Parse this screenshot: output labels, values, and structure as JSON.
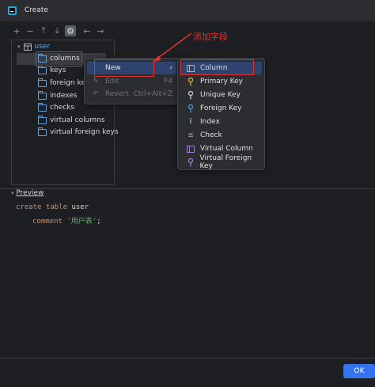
{
  "window": {
    "title": "Create",
    "app_icon": "datagrip-icon"
  },
  "toolbar": [
    {
      "name": "add-icon",
      "glyph": "+"
    },
    {
      "name": "remove-icon",
      "glyph": "−"
    },
    {
      "name": "move-up-icon",
      "glyph": "⤒"
    },
    {
      "name": "move-down-icon",
      "glyph": "⤓"
    },
    {
      "name": "settings-icon",
      "glyph": "⚙"
    },
    {
      "name": "back-icon",
      "glyph": "←"
    },
    {
      "name": "forward-icon",
      "glyph": "→"
    }
  ],
  "tree": {
    "root": "user",
    "items": [
      "columns",
      "keys",
      "foreign keys",
      "indexes",
      "checks",
      "virtual columns",
      "virtual foreign keys"
    ]
  },
  "context_menu": {
    "items": [
      {
        "label": "New",
        "shortcut": "",
        "disabled": false
      },
      {
        "label": "Edit",
        "shortcut": "F4",
        "disabled": true
      },
      {
        "label": "Revert",
        "shortcut": "Ctrl+Alt+Z",
        "disabled": true
      }
    ]
  },
  "submenu": {
    "items": [
      {
        "label": "Column",
        "icon": "column-icon"
      },
      {
        "label": "Primary Key",
        "icon": "primary-key-icon"
      },
      {
        "label": "Unique Key",
        "icon": "unique-key-icon"
      },
      {
        "label": "Foreign Key",
        "icon": "foreign-key-icon"
      },
      {
        "label": "Index",
        "icon": "index-icon"
      },
      {
        "label": "Check",
        "icon": "check-icon"
      },
      {
        "label": "Virtual Column",
        "icon": "virtual-column-icon"
      },
      {
        "label": "Virtual Foreign Key",
        "icon": "virtual-foreign-key-icon"
      }
    ]
  },
  "annotation": {
    "text": "添加字段",
    "color": "#e03131"
  },
  "preview": {
    "label": "Preview",
    "line1_kw": "create table",
    "line1_name": "user",
    "line2_kw": "comment",
    "line2_str": "'用户表'",
    "line2_end": ";"
  },
  "buttons": {
    "ok": "OK"
  },
  "colors": {
    "accent": "#3574f0",
    "selection": "#2e436e",
    "annotation": "#e03131"
  }
}
